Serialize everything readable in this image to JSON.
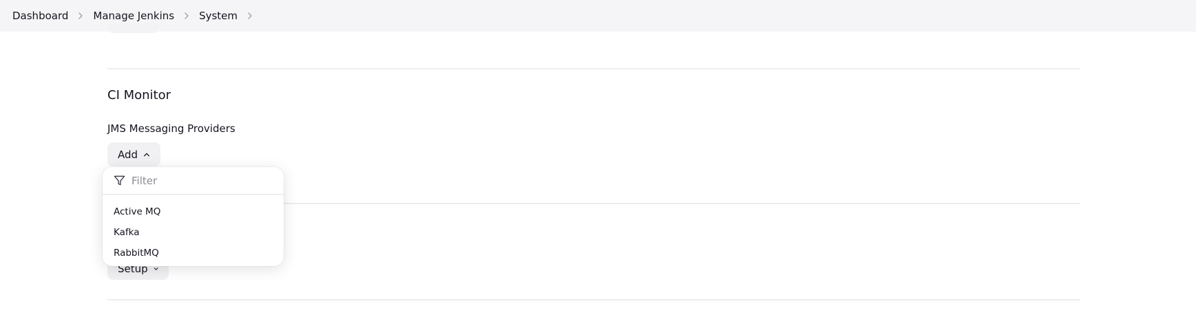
{
  "breadcrumb": {
    "items": [
      "Dashboard",
      "Manage Jenkins",
      "System"
    ]
  },
  "section": {
    "title": "CI Monitor",
    "field_label": "JMS Messaging Providers",
    "add_button": "Add",
    "setup_button": "Setup"
  },
  "dropdown": {
    "filter_placeholder": "Filter",
    "filter_value": "",
    "items": [
      "Active MQ",
      "Kafka",
      "RabbitMQ"
    ]
  },
  "colors": {
    "topbar_bg": "#f5f5f7",
    "button_bg": "#f1f1f3",
    "text": "#14141f",
    "divider": "#ededf0"
  },
  "icons": {
    "breadcrumb_separator": "chevron-right-icon",
    "add_button_icon": "chevron-up-icon",
    "setup_button_icon": "chevron-down-icon",
    "filter_icon": "funnel-icon"
  }
}
